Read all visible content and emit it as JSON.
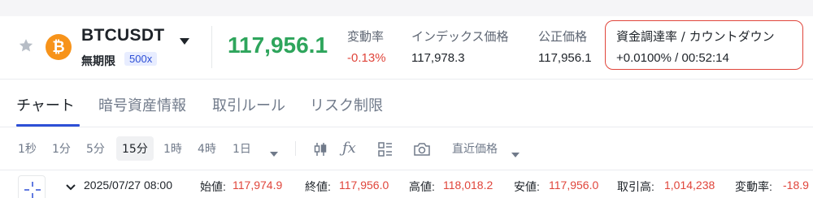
{
  "colors": {
    "accent": "#2d4fd6",
    "up": "#2ea55c",
    "down": "#e0453b",
    "coin": "#f7931a",
    "highlight_border": "#e0453b"
  },
  "ticker": {
    "symbol": "BTCUSDT",
    "contract_type": "無期限",
    "leverage": "500x",
    "last_price": "117,956.1",
    "stats": {
      "change": {
        "label": "変動率",
        "value": "-0.13%"
      },
      "index_price": {
        "label": "インデックス価格",
        "value": "117,978.3"
      },
      "fair_price": {
        "label": "公正価格",
        "value": "117,956.1"
      },
      "funding": {
        "label": "資金調達率 / カウントダウン",
        "value": "+0.0100% / 00:52:14"
      }
    },
    "icons": {
      "favorite": "star-icon",
      "coin": "bitcoin-icon",
      "dropdown": "caret-down-icon"
    }
  },
  "tabs": [
    {
      "label": "チャート",
      "active": true
    },
    {
      "label": "暗号資産情報",
      "active": false
    },
    {
      "label": "取引ルール",
      "active": false
    },
    {
      "label": "リスク制限",
      "active": false
    }
  ],
  "toolbar": {
    "timeframes": [
      "1秒",
      "1分",
      "5分",
      "15分",
      "1時",
      "4時",
      "1日"
    ],
    "active_timeframe": "15分",
    "price_type": "直近価格",
    "icons": [
      "candlestick-icon",
      "indicator-fx-icon",
      "layout-grid-icon",
      "camera-icon"
    ]
  },
  "ohlc": {
    "datetime": "2025/07/27 08:00",
    "open_label": "始値:",
    "open": "117,974.9",
    "close_label": "終値:",
    "close": "117,956.0",
    "high_label": "高値:",
    "high": "118,018.2",
    "low_label": "安値:",
    "low": "117,956.0",
    "volume_label": "取引高:",
    "volume": "1,014,238",
    "change_label": "変動率:",
    "change": "-18.9"
  }
}
